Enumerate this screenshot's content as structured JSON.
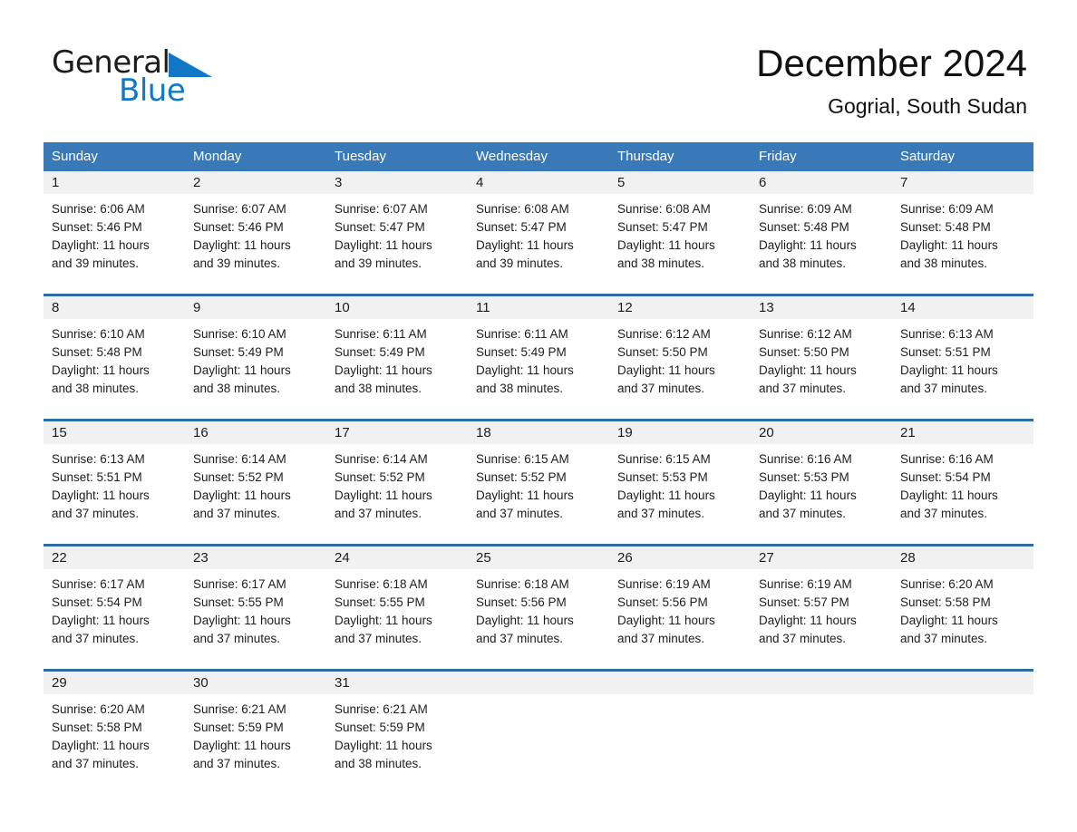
{
  "brand": {
    "name_part1": "General",
    "name_part2": "Blue",
    "triangle_icon": "triangle-icon",
    "accent_color": "#1277c4"
  },
  "header": {
    "month_title": "December 2024",
    "location": "Gogrial, South Sudan"
  },
  "theme": {
    "header_blue": "#3a79b8",
    "separator_blue": "#2e6da4",
    "daynum_band": "#f1f1f1",
    "text": "#1d1d1d"
  },
  "calendar": {
    "weekdays": [
      "Sunday",
      "Monday",
      "Tuesday",
      "Wednesday",
      "Thursday",
      "Friday",
      "Saturday"
    ],
    "weeks": [
      {
        "days": [
          {
            "num": "1",
            "detail": "Sunrise: 6:06 AM\nSunset: 5:46 PM\nDaylight: 11 hours\nand 39 minutes."
          },
          {
            "num": "2",
            "detail": "Sunrise: 6:07 AM\nSunset: 5:46 PM\nDaylight: 11 hours\nand 39 minutes."
          },
          {
            "num": "3",
            "detail": "Sunrise: 6:07 AM\nSunset: 5:47 PM\nDaylight: 11 hours\nand 39 minutes."
          },
          {
            "num": "4",
            "detail": "Sunrise: 6:08 AM\nSunset: 5:47 PM\nDaylight: 11 hours\nand 39 minutes."
          },
          {
            "num": "5",
            "detail": "Sunrise: 6:08 AM\nSunset: 5:47 PM\nDaylight: 11 hours\nand 38 minutes."
          },
          {
            "num": "6",
            "detail": "Sunrise: 6:09 AM\nSunset: 5:48 PM\nDaylight: 11 hours\nand 38 minutes."
          },
          {
            "num": "7",
            "detail": "Sunrise: 6:09 AM\nSunset: 5:48 PM\nDaylight: 11 hours\nand 38 minutes."
          }
        ]
      },
      {
        "days": [
          {
            "num": "8",
            "detail": "Sunrise: 6:10 AM\nSunset: 5:48 PM\nDaylight: 11 hours\nand 38 minutes."
          },
          {
            "num": "9",
            "detail": "Sunrise: 6:10 AM\nSunset: 5:49 PM\nDaylight: 11 hours\nand 38 minutes."
          },
          {
            "num": "10",
            "detail": "Sunrise: 6:11 AM\nSunset: 5:49 PM\nDaylight: 11 hours\nand 38 minutes."
          },
          {
            "num": "11",
            "detail": "Sunrise: 6:11 AM\nSunset: 5:49 PM\nDaylight: 11 hours\nand 38 minutes."
          },
          {
            "num": "12",
            "detail": "Sunrise: 6:12 AM\nSunset: 5:50 PM\nDaylight: 11 hours\nand 37 minutes."
          },
          {
            "num": "13",
            "detail": "Sunrise: 6:12 AM\nSunset: 5:50 PM\nDaylight: 11 hours\nand 37 minutes."
          },
          {
            "num": "14",
            "detail": "Sunrise: 6:13 AM\nSunset: 5:51 PM\nDaylight: 11 hours\nand 37 minutes."
          }
        ]
      },
      {
        "days": [
          {
            "num": "15",
            "detail": "Sunrise: 6:13 AM\nSunset: 5:51 PM\nDaylight: 11 hours\nand 37 minutes."
          },
          {
            "num": "16",
            "detail": "Sunrise: 6:14 AM\nSunset: 5:52 PM\nDaylight: 11 hours\nand 37 minutes."
          },
          {
            "num": "17",
            "detail": "Sunrise: 6:14 AM\nSunset: 5:52 PM\nDaylight: 11 hours\nand 37 minutes."
          },
          {
            "num": "18",
            "detail": "Sunrise: 6:15 AM\nSunset: 5:52 PM\nDaylight: 11 hours\nand 37 minutes."
          },
          {
            "num": "19",
            "detail": "Sunrise: 6:15 AM\nSunset: 5:53 PM\nDaylight: 11 hours\nand 37 minutes."
          },
          {
            "num": "20",
            "detail": "Sunrise: 6:16 AM\nSunset: 5:53 PM\nDaylight: 11 hours\nand 37 minutes."
          },
          {
            "num": "21",
            "detail": "Sunrise: 6:16 AM\nSunset: 5:54 PM\nDaylight: 11 hours\nand 37 minutes."
          }
        ]
      },
      {
        "days": [
          {
            "num": "22",
            "detail": "Sunrise: 6:17 AM\nSunset: 5:54 PM\nDaylight: 11 hours\nand 37 minutes."
          },
          {
            "num": "23",
            "detail": "Sunrise: 6:17 AM\nSunset: 5:55 PM\nDaylight: 11 hours\nand 37 minutes."
          },
          {
            "num": "24",
            "detail": "Sunrise: 6:18 AM\nSunset: 5:55 PM\nDaylight: 11 hours\nand 37 minutes."
          },
          {
            "num": "25",
            "detail": "Sunrise: 6:18 AM\nSunset: 5:56 PM\nDaylight: 11 hours\nand 37 minutes."
          },
          {
            "num": "26",
            "detail": "Sunrise: 6:19 AM\nSunset: 5:56 PM\nDaylight: 11 hours\nand 37 minutes."
          },
          {
            "num": "27",
            "detail": "Sunrise: 6:19 AM\nSunset: 5:57 PM\nDaylight: 11 hours\nand 37 minutes."
          },
          {
            "num": "28",
            "detail": "Sunrise: 6:20 AM\nSunset: 5:58 PM\nDaylight: 11 hours\nand 37 minutes."
          }
        ]
      },
      {
        "days": [
          {
            "num": "29",
            "detail": "Sunrise: 6:20 AM\nSunset: 5:58 PM\nDaylight: 11 hours\nand 37 minutes."
          },
          {
            "num": "30",
            "detail": "Sunrise: 6:21 AM\nSunset: 5:59 PM\nDaylight: 11 hours\nand 37 minutes."
          },
          {
            "num": "31",
            "detail": "Sunrise: 6:21 AM\nSunset: 5:59 PM\nDaylight: 11 hours\nand 38 minutes."
          },
          {
            "num": "",
            "detail": ""
          },
          {
            "num": "",
            "detail": ""
          },
          {
            "num": "",
            "detail": ""
          },
          {
            "num": "",
            "detail": ""
          }
        ]
      }
    ]
  }
}
